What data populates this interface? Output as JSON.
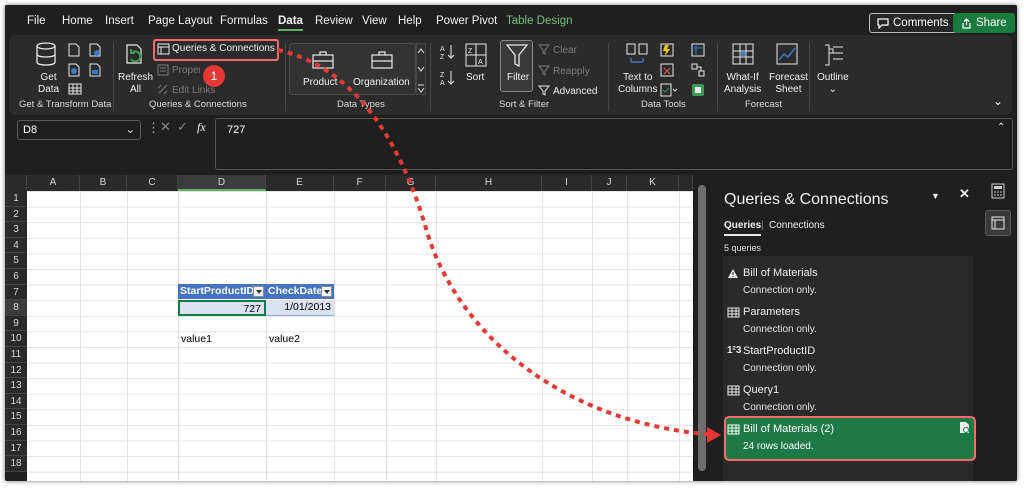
{
  "menu": {
    "tabs": [
      "File",
      "Home",
      "Insert",
      "Page Layout",
      "Formulas",
      "Data",
      "Review",
      "View",
      "Help",
      "Power Pivot",
      "Table Design"
    ],
    "active_tab": "Data",
    "comments_label": "Comments",
    "share_label": "Share"
  },
  "ribbon": {
    "get_data": {
      "line1": "Get",
      "line2": "Data"
    },
    "get_transform_label": "Get & Transform Data",
    "refresh": {
      "line1": "Refresh",
      "line2": "All"
    },
    "queries_connections_btn": "Queries & Connections",
    "properties_btn": "Properties",
    "edit_links_btn": "Edit Links",
    "queries_group_label": "Queries & Connections",
    "product_btn": "Product",
    "organization_btn": "Organization",
    "data_types_label": "Data Types",
    "sort_btn": "Sort",
    "filter_btn": "Filter",
    "clear_btn": "Clear",
    "reapply_btn": "Reapply",
    "advanced_btn": "Advanced",
    "sort_filter_label": "Sort & Filter",
    "text_to_columns": {
      "line1": "Text to",
      "line2": "Columns"
    },
    "data_tools_label": "Data Tools",
    "what_if": {
      "line1": "What-If",
      "line2": "Analysis"
    },
    "forecast_sheet": {
      "line1": "Forecast",
      "line2": "Sheet"
    },
    "forecast_label": "Forecast",
    "outline_btn": "Outline"
  },
  "formula_bar": {
    "name_box": "D8",
    "formula": "727"
  },
  "sheet": {
    "columns": [
      "A",
      "B",
      "C",
      "D",
      "E",
      "F",
      "G",
      "H",
      "I",
      "J",
      "K"
    ],
    "rows": [
      "1",
      "2",
      "3",
      "4",
      "5",
      "6",
      "7",
      "8",
      "9",
      "10",
      "11",
      "12",
      "13",
      "14",
      "15",
      "16",
      "17",
      "18"
    ],
    "table_headers": [
      "StartProductID",
      "CheckDate"
    ],
    "table_values": [
      "727",
      "1/01/2013"
    ],
    "value1": "value1",
    "value2": "value2"
  },
  "callout_number": "1",
  "queries_pane": {
    "title": "Queries & Connections",
    "tab_queries": "Queries",
    "tab_connections": "Connections",
    "count": "5 queries",
    "items": [
      {
        "name": "Bill of Materials",
        "status": "Connection only.",
        "icon": "warning-icon"
      },
      {
        "name": "Parameters",
        "status": "Connection only.",
        "icon": "table-icon"
      },
      {
        "name": "StartProductID",
        "status": "Connection only.",
        "icon": "number-type-icon"
      },
      {
        "name": "Query1",
        "status": "Connection only.",
        "icon": "table-icon"
      },
      {
        "name": "Bill of Materials (2)",
        "status": "24 rows loaded.",
        "icon": "table-icon"
      }
    ]
  },
  "colors": {
    "accent_green": "#1d7a44",
    "table_header": "#4472c4",
    "highlight": "#ff6b6b"
  }
}
